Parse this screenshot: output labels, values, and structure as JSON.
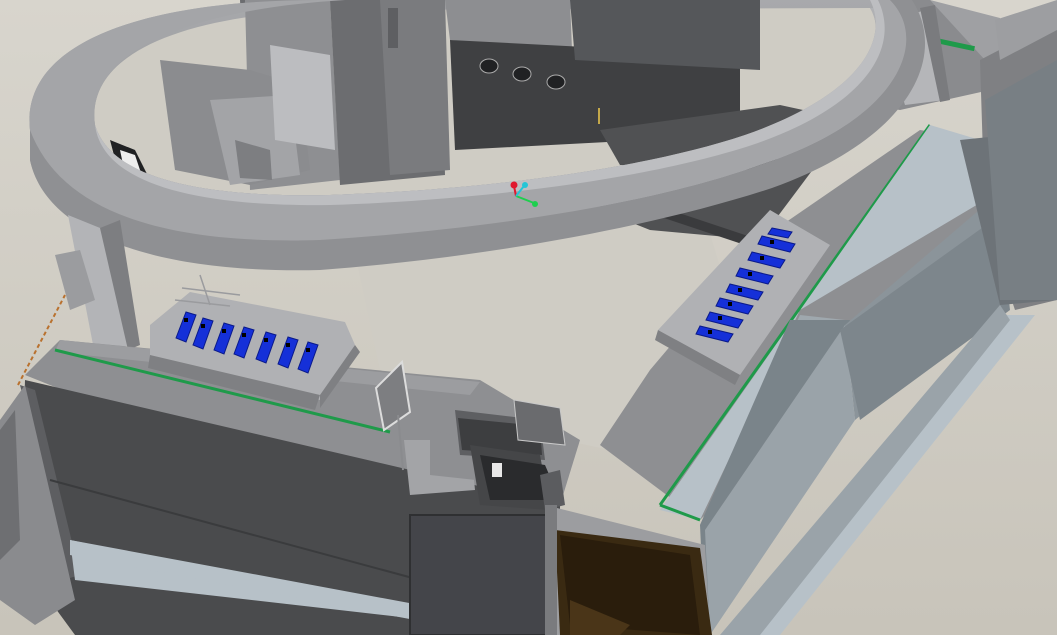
{
  "scene": {
    "subject": "cad-assembly-render",
    "counts": {
      "phones_left_panel": 7,
      "phones_right_panel": 8,
      "vents": 3
    },
    "colors": {
      "background": "#cfccc4",
      "body_dark": "#4a4b4d",
      "body_mid": "#8e8f92",
      "body_light": "#a9aaad",
      "panel_blue": "#b7c1c8",
      "green_strip": "#1f9a4a",
      "phone_blue": "#1530d8",
      "cabinet_brown": "#3a2a12",
      "axis_x": "#e0182f",
      "axis_y": "#1ecf4e",
      "axis_z": "#23c5d6"
    }
  }
}
